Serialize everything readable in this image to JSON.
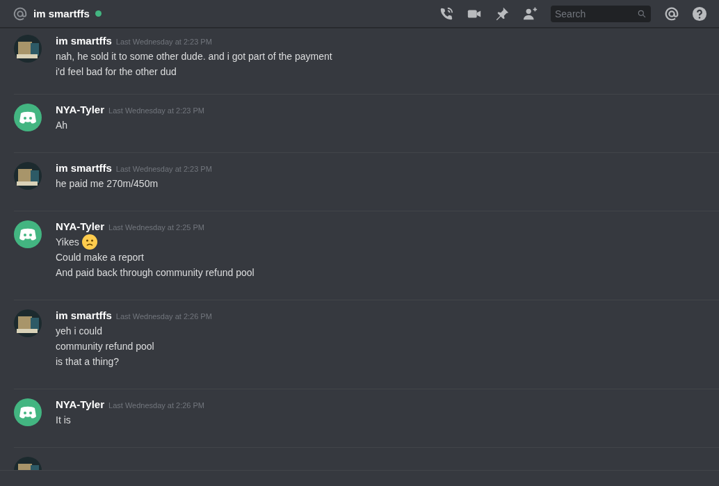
{
  "header": {
    "channel": "im smartffs",
    "online": true,
    "search": {
      "placeholder": "Search"
    }
  },
  "messages": [
    {
      "author": "im smartffs",
      "kind": "photo",
      "time": "Last Wednesday at 2:23 PM",
      "lines": [
        {
          "text": "nah, he sold it to some other dude. and i got part of the payment",
          "emoji": false
        },
        {
          "text": "i'd feel bad for the other dud",
          "emoji": false
        }
      ]
    },
    {
      "author": "NYA-Tyler",
      "kind": "bot",
      "time": "Last Wednesday at 2:23 PM",
      "lines": [
        {
          "text": "Ah",
          "emoji": false
        }
      ]
    },
    {
      "author": "im smartffs",
      "kind": "photo",
      "time": "Last Wednesday at 2:23 PM",
      "lines": [
        {
          "text": "he paid me 270m/450m",
          "emoji": false
        }
      ]
    },
    {
      "author": "NYA-Tyler",
      "kind": "bot",
      "time": "Last Wednesday at 2:25 PM",
      "lines": [
        {
          "text": "Yikes",
          "emoji": true
        },
        {
          "text": "Could make a report",
          "emoji": false
        },
        {
          "text": "And paid back through community refund pool",
          "emoji": false
        }
      ]
    },
    {
      "author": "im smartffs",
      "kind": "photo",
      "time": "Last Wednesday at 2:26 PM",
      "lines": [
        {
          "text": "yeh i could",
          "emoji": false
        },
        {
          "text": "community refund pool",
          "emoji": false
        },
        {
          "text": "is that a thing?",
          "emoji": false
        }
      ]
    },
    {
      "author": "NYA-Tyler",
      "kind": "bot",
      "time": "Last Wednesday at 2:26 PM",
      "lines": [
        {
          "text": "It is",
          "emoji": false
        }
      ]
    },
    {
      "kind": "photo"
    }
  ]
}
